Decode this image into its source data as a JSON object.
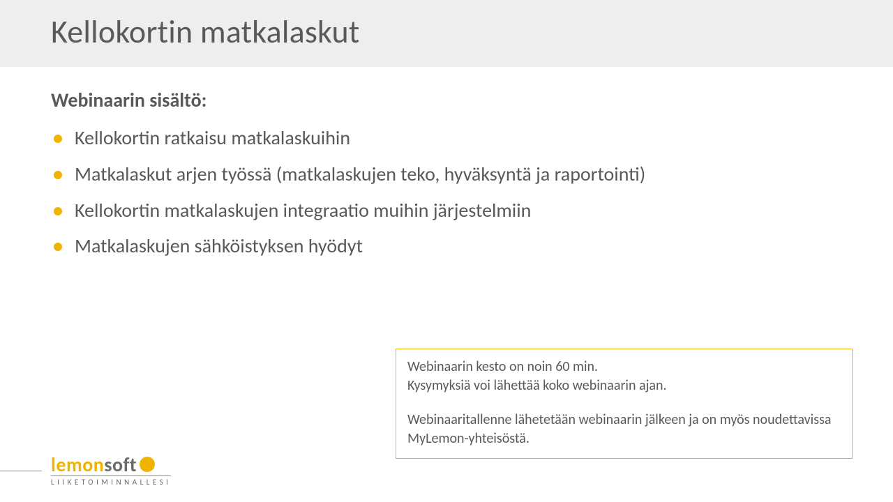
{
  "title": "Kellokortin matkalaskut",
  "subtitle": "Webinaarin sisältö:",
  "bullets": [
    "Kellokortin ratkaisu matkalaskuihin",
    "Matkalaskut arjen työssä (matkalaskujen teko, hyväksyntä ja raportointi)",
    "Kellokortin matkalaskujen integraatio muihin järjestelmiin",
    "Matkalaskujen sähköistyksen hyödyt"
  ],
  "info": {
    "line1": "Webinaarin kesto on noin 60 min.",
    "line2": "Kysymyksiä voi lähettää koko webinaarin ajan.",
    "line3": "Webinaaritallenne lähetetään webinaarin jälkeen ja on myös noudettavissa MyLemon-yhteisöstä."
  },
  "logo": {
    "lemon": "lemon",
    "soft": "soft",
    "tagline": "LIIKETOIMINNALLESI"
  }
}
